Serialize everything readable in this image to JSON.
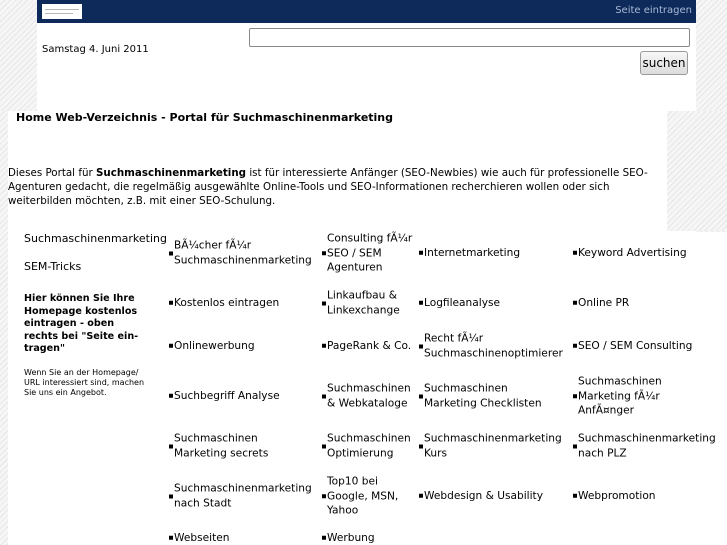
{
  "header": {
    "seite_link": "Seite eintragen"
  },
  "search": {
    "date": "Samstag 4. Juni 2011",
    "value": "",
    "button_label": "suchen"
  },
  "page": {
    "title": "Home Web-Verzeichnis - Portal für Suchmaschinenmarketing",
    "intro_before": "Dieses Portal für ",
    "intro_bold": "Suchmaschinenmarketing",
    "intro_after": " ist für interessierte Anfänger (SEO-Newbies) wie auch für professionelle SEO-Agenturen gedacht, die regelmäßig ausgewählte Online-Tools und SEO-Informationen recherchieren wollen oder sich weiterbilden möchten, z.B. mit einer SEO-Schulung."
  },
  "sidebar": {
    "links": [
      "Suchmaschinenmarketing",
      "SEM-Tricks"
    ],
    "cta": "Hier können Sie Ihre Homepage kostenlos eintragen - oben rechts bei \"Seite ein-tragen\"",
    "note": "Wenn Sie an der Homepage/ URL interessiert sind, machen Sie uns ein Angebot."
  },
  "categories": [
    "BÃ¼cher fÃ¼r\nSuchmaschinenmarketing",
    "Consulting fÃ¼r\nSEO / SEM\nAgenturen",
    "Internetmarketing",
    "Keyword Advertising",
    "Kostenlos eintragen",
    "Linkaufbau &\nLinkexchange",
    "Logfileanalyse",
    "Online PR",
    "Onlinewerbung",
    "PageRank & Co.",
    "Recht fÃ¼r\nSuchmaschinenoptimierer",
    "SEO / SEM Consulting",
    "Suchbegriff Analyse",
    "Suchmaschinen\n& Webkataloge",
    "Suchmaschinen\nMarketing Checklisten",
    "Suchmaschinen\nMarketing fÃ¼r\nAnfÃ¤nger",
    "Suchmaschinen\nMarketing secrets",
    "Suchmaschinen\nOptimierung",
    "Suchmaschinenmarketing\nKurs",
    "Suchmaschinenmarketing\nnach PLZ",
    "Suchmaschinenmarketing\nnach Stadt",
    "Top10 bei\nGoogle, MSN,\nYahoo",
    "Webdesign & Usability",
    "Webpromotion",
    "Webseiten",
    "Werbung"
  ]
}
